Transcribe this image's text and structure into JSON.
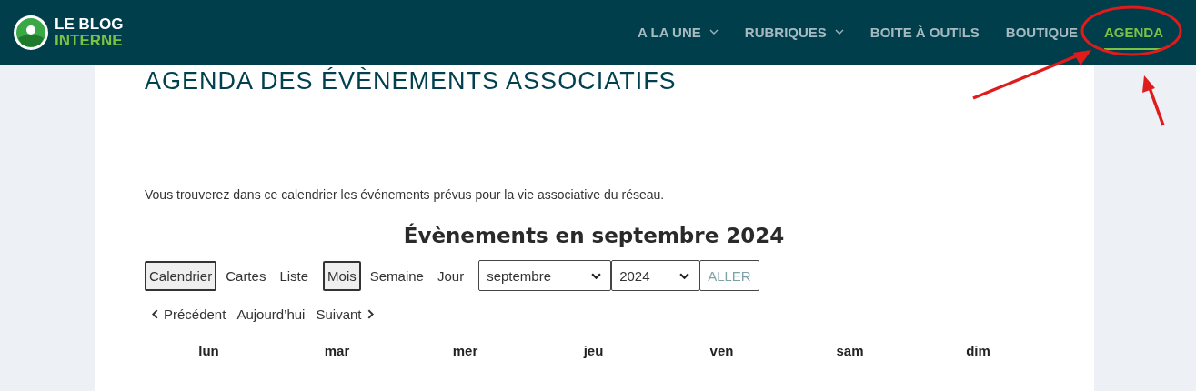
{
  "header": {
    "logo": {
      "line1": "LE BLOG",
      "line2": "INTERNE"
    },
    "nav": [
      {
        "label": "A LA UNE",
        "dropdown": true,
        "selected": false
      },
      {
        "label": "RUBRIQUES",
        "dropdown": true,
        "selected": false
      },
      {
        "label": "BOITE À OUTILS",
        "dropdown": false,
        "selected": false
      },
      {
        "label": "BOUTIQUE",
        "dropdown": false,
        "selected": false
      },
      {
        "label": "AGENDA",
        "dropdown": false,
        "selected": true
      }
    ]
  },
  "page_title": "AGENDA DES ÉVÈNEMENTS ASSOCIATIFS",
  "intro": "Vous trouverez dans ce calendrier les événements prévus pour la vie associative du réseau.",
  "calendar": {
    "heading": "Évènements en septembre 2024",
    "views": [
      {
        "label": "Calendrier",
        "selected": true
      },
      {
        "label": "Cartes",
        "selected": false
      },
      {
        "label": "Liste",
        "selected": false
      }
    ],
    "periods": [
      {
        "label": "Mois",
        "selected": true
      },
      {
        "label": "Semaine",
        "selected": false
      },
      {
        "label": "Jour",
        "selected": false
      }
    ],
    "month_select": "septembre",
    "year_select": "2024",
    "go_button": "ALLER",
    "prev": "Précédent",
    "today": "Aujourd’hui",
    "next": "Suivant",
    "weekdays": [
      "lun",
      "mar",
      "mer",
      "jeu",
      "ven",
      "sam",
      "dim"
    ]
  }
}
